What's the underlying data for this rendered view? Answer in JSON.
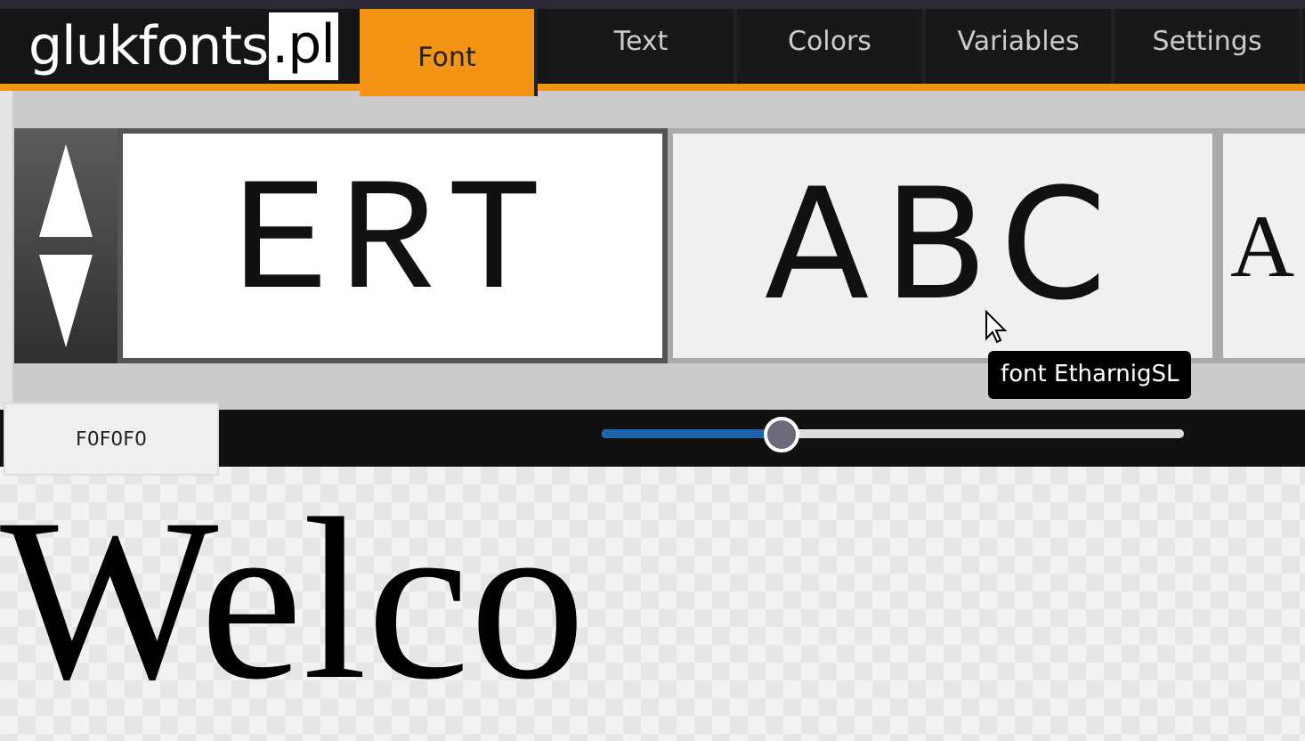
{
  "logo": {
    "text": "glukfonts",
    "suffix": ".pl"
  },
  "tabs": [
    {
      "label": "Font",
      "selected": true
    },
    {
      "label": "Text",
      "selected": false
    },
    {
      "label": "Colors",
      "selected": false
    },
    {
      "label": "Variables",
      "selected": false
    },
    {
      "label": "Settings",
      "selected": false
    }
  ],
  "font_samples": [
    {
      "text": "ERT",
      "selected": true,
      "kind": "mono"
    },
    {
      "text": "ABC",
      "selected": false,
      "kind": "sans"
    },
    {
      "text": "A",
      "selected": false,
      "kind": "serif"
    }
  ],
  "tooltip": "font EtharnigSL",
  "background_color_field": {
    "value": "F0F0F0"
  },
  "size_slider": {
    "level": 0.31
  },
  "preview_text": "Welco"
}
